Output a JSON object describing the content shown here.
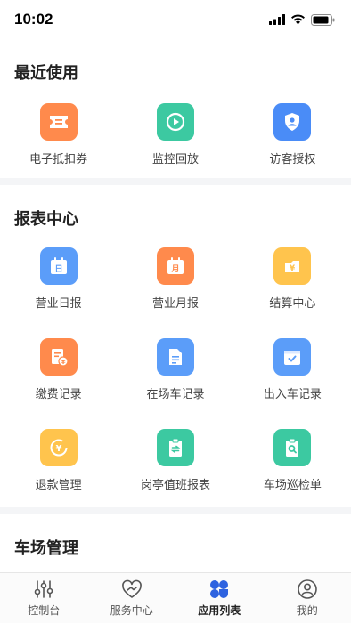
{
  "status_bar": {
    "time": "10:02"
  },
  "sections": {
    "recent": {
      "title": "最近使用",
      "items": [
        {
          "label": "电子抵扣券",
          "icon": "ticket-icon",
          "color": "#FF8A4C"
        },
        {
          "label": "监控回放",
          "icon": "playback-icon",
          "color": "#3CC9A1"
        },
        {
          "label": "访客授权",
          "icon": "visitor-shield-icon",
          "color": "#4A8CF7"
        }
      ]
    },
    "reports": {
      "title": "报表中心",
      "items": [
        {
          "label": "营业日报",
          "icon": "calendar-day-icon",
          "glyph": "日",
          "color": "#5B9DF9"
        },
        {
          "label": "营业月报",
          "icon": "calendar-month-icon",
          "glyph": "月",
          "color": "#FF8A4C"
        },
        {
          "label": "结算中心",
          "icon": "wallet-yen-icon",
          "glyph": "¥",
          "color": "#FFC44D"
        },
        {
          "label": "缴费记录",
          "icon": "payment-record-icon",
          "glyph": "¥",
          "color": "#FF8A4C"
        },
        {
          "label": "在场车记录",
          "icon": "document-icon",
          "color": "#5B9DF9"
        },
        {
          "label": "出入车记录",
          "icon": "checked-calendar-icon",
          "color": "#5B9DF9"
        },
        {
          "label": "退款管理",
          "icon": "refund-icon",
          "glyph": "¥",
          "color": "#FFC44D"
        },
        {
          "label": "岗亭值班报表",
          "icon": "shift-clipboard-icon",
          "color": "#3CC9A1"
        },
        {
          "label": "车场巡检单",
          "icon": "inspection-clipboard-icon",
          "color": "#3CC9A1"
        }
      ]
    },
    "parking": {
      "title": "车场管理"
    }
  },
  "bottom_nav": [
    {
      "label": "控制台",
      "icon": "sliders-icon",
      "active": false
    },
    {
      "label": "服务中心",
      "icon": "heart-hand-icon",
      "active": false
    },
    {
      "label": "应用列表",
      "icon": "apps-icon",
      "active": true
    },
    {
      "label": "我的",
      "icon": "user-icon",
      "active": false
    }
  ]
}
